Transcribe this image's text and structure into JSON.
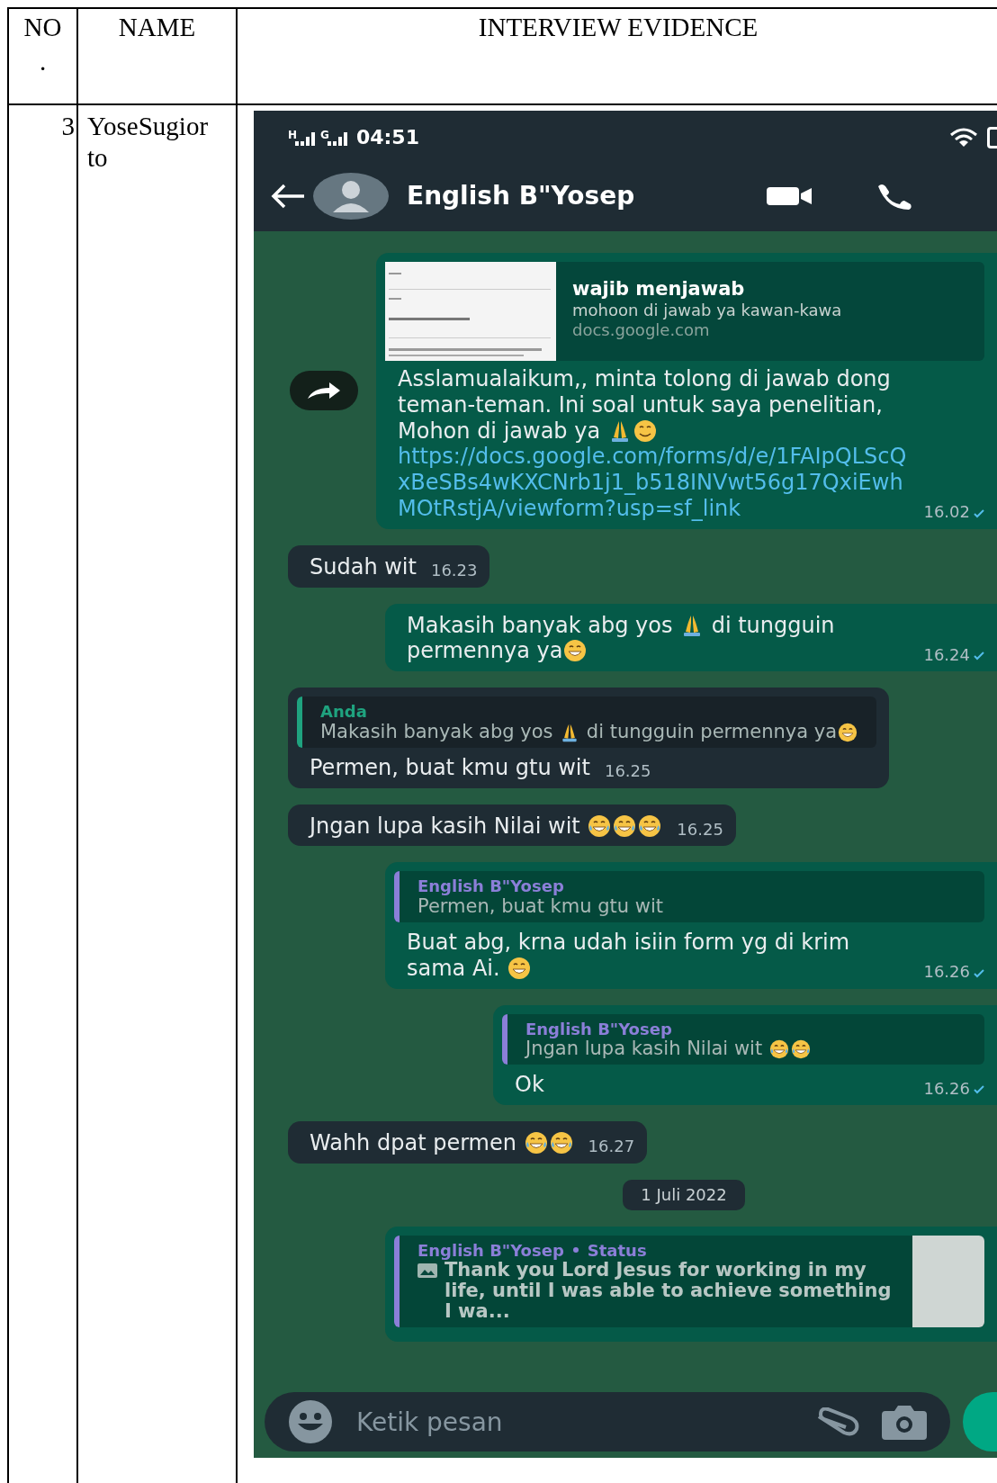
{
  "table": {
    "columns": [
      "NO.",
      "NAME",
      "INTERVIEW EVIDENCE"
    ],
    "rows": [
      {
        "no": "3",
        "name": "YoseSugiorto",
        "phone": {
          "status_bar": {
            "networks": [
              "H",
              "G"
            ],
            "time": "04:51"
          },
          "chat_header": {
            "title": "English B\"Yosep"
          },
          "messages": [
            {
              "kind": "out",
              "forwarded": true,
              "preview": {
                "title": "wajib menjawab",
                "description": "mohoon di jawab ya kawan-kawa",
                "domain": "docs.google.com"
              },
              "parts": [
                {
                  "kind": "text",
                  "text": "Asslamualaikum,,  minta tolong di jawab dong teman-teman. Ini soal untuk saya penelitian, Mohon di jawab ya "
                },
                {
                  "kind": "pray"
                },
                {
                  "kind": "smile"
                }
              ],
              "link": "https://docs.google.com/forms/d/e/1FAIpQLScQxBeSBs4wKXCNrb1j1_b518INVwt56g17QxiEwhMOtRstjA/viewform?usp=sf_link",
              "time": "16.02"
            },
            {
              "kind": "in",
              "parts": [
                {
                  "kind": "text",
                  "text": "Sudah wit"
                }
              ],
              "time": "16.23"
            },
            {
              "kind": "out",
              "parts": [
                {
                  "kind": "text",
                  "text": "Makasih banyak abg yos "
                },
                {
                  "kind": "pray"
                },
                {
                  "kind": "text",
                  "text": " di tungguin permennya ya"
                },
                {
                  "kind": "grin"
                }
              ],
              "time": "16.24"
            },
            {
              "kind": "in",
              "quote": {
                "author": "Anda",
                "color": "#1fa37f",
                "parts": [
                  {
                    "kind": "text",
                    "text": "Makasih banyak abg yos "
                  },
                  {
                    "kind": "pray"
                  },
                  {
                    "kind": "text",
                    "text": " di tungguin permennya ya"
                  },
                  {
                    "kind": "grin"
                  }
                ]
              },
              "parts": [
                {
                  "kind": "text",
                  "text": "Permen, buat kmu gtu wit"
                }
              ],
              "time": "16.25"
            },
            {
              "kind": "in",
              "parts": [
                {
                  "kind": "text",
                  "text": "Jngan lupa kasih Nilai wit "
                },
                {
                  "kind": "laugh"
                },
                {
                  "kind": "laugh"
                },
                {
                  "kind": "laugh"
                }
              ],
              "time": "16.25"
            },
            {
              "kind": "out",
              "quote": {
                "author": "English B\"Yosep",
                "color": "#8b7fd8",
                "parts": [
                  {
                    "kind": "text",
                    "text": "Permen, buat kmu gtu wit"
                  }
                ]
              },
              "parts": [
                {
                  "kind": "text",
                  "text": "Buat abg, krna udah isiin form yg di krim sama Ai. "
                },
                {
                  "kind": "grin"
                }
              ],
              "time": "16.26"
            },
            {
              "kind": "out",
              "quote": {
                "author": "English B\"Yosep",
                "color": "#8b7fd8",
                "parts": [
                  {
                    "kind": "text",
                    "text": "Jngan lupa kasih Nilai wit "
                  },
                  {
                    "kind": "laugh"
                  },
                  {
                    "kind": "laugh"
                  }
                ]
              },
              "parts": [
                {
                  "kind": "text",
                  "text": "Ok"
                }
              ],
              "time": "16.26"
            },
            {
              "kind": "in",
              "parts": [
                {
                  "kind": "text",
                  "text": "Wahh dpat permen "
                },
                {
                  "kind": "laugh"
                },
                {
                  "kind": "laugh"
                }
              ],
              "time": "16.27"
            },
            {
              "kind": "date",
              "label": "1 Juli 2022"
            },
            {
              "kind": "status",
              "quote": {
                "author": "English B\"Yosep",
                "tag": "Status",
                "color": "#8b7fd8",
                "text": "Thank you Lord Jesus for working in my life, until I was able to achieve something I wa..."
              }
            }
          ],
          "input": {
            "placeholder": "Ketik pesan"
          }
        }
      }
    ]
  }
}
